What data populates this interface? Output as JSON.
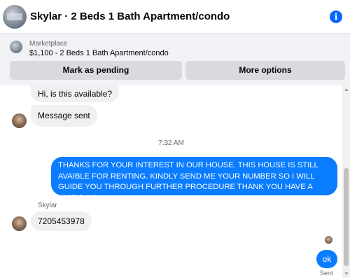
{
  "header": {
    "title": "Skylar · 2 Beds 1 Bath Apartment/condo",
    "info_glyph": "i"
  },
  "listing": {
    "source": "Marketplace",
    "summary": "$1,100 - 2 Beds 1 Bath Apartment/condo",
    "mark_pending_label": "Mark as pending",
    "more_options_label": "More options"
  },
  "messages": {
    "incoming_1": "Hi, is this available?",
    "incoming_2": "Message sent",
    "timestamp": "7:32 AM",
    "outgoing_1": "THANKS FOR YOUR INTEREST IN OUR HOUSE. THIS HOUSE IS STILL AVAIBLE FOR RENTING. KINDLY SEND ME YOUR NUMBER SO I WILL GUIDE YOU THROUGH FURTHER PROCEDURE THANK YOU HAVE A NICE DAY!",
    "sender_name": "Skylar",
    "incoming_3": "7205453978",
    "outgoing_2": "ok",
    "delivery_status": "Sent"
  },
  "colors": {
    "accent": "#0a7cff",
    "panel_bg": "#f0f2f5",
    "button_bg": "#d8dadf",
    "incoming_bubble": "#f0f0f0",
    "secondary_text": "#65676b"
  },
  "icons": {
    "info": "info-icon",
    "avatar": "contact-avatar",
    "listing_thumbnail": "listing-thumbnail"
  }
}
